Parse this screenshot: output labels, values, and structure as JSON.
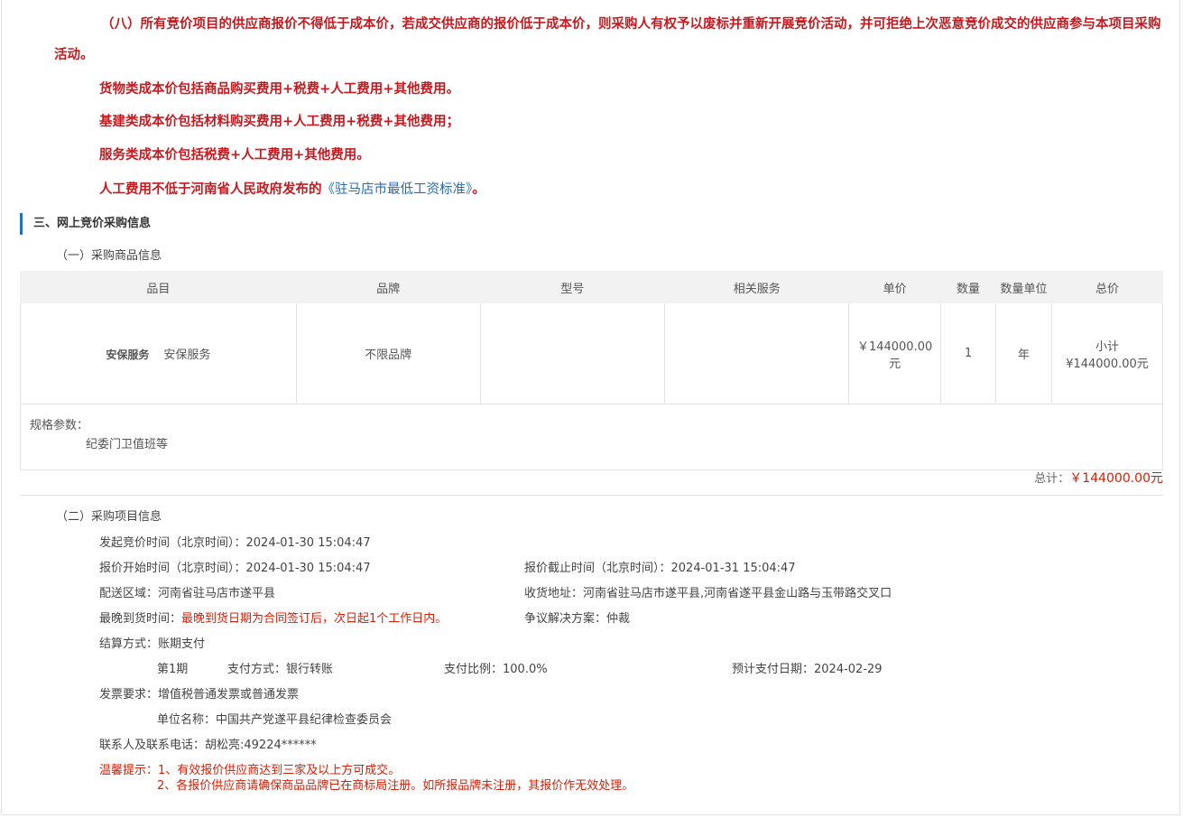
{
  "rules": {
    "item8": "（八）所有竞价项目的供应商报价不得低于成本价，若成交供应商的报价低于成本价，则采购人有权予以废标并重新开展竞价活动，并可拒绝上次恶意竞价成交的供应商参与本项目采购活动。",
    "goods_cost": "货物类成本价包括商品购买费用+税费+人工费用+其他费用。",
    "construction_cost": "基建类成本价包括材料购买费用+人工费用+税费+其他费用；",
    "service_cost": "服务类成本价包括税费+人工费用+其他费用。",
    "labor_prefix": "人工费用不低于河南省人民政府发布的",
    "labor_link": "《驻马店市最低工资标准》",
    "labor_suffix": "。"
  },
  "section3": {
    "title": "三、网上竞价采购信息",
    "sub1": "（一）采购商品信息",
    "sub2": "（二）采购项目信息"
  },
  "goods_table": {
    "headers": [
      "品目",
      "品牌",
      "型号",
      "相关服务",
      "单价",
      "数量",
      "数量单位",
      "总价"
    ],
    "row": {
      "category_code": "安保服务",
      "category_name": "安保服务",
      "brand": "不限品牌",
      "model": "",
      "service": "",
      "unit_price": "￥144000.00 元",
      "qty": "1",
      "unit": "年",
      "subtotal_label": "小计",
      "subtotal": "¥144000.00元"
    },
    "spec_label": "规格参数：",
    "spec_value": "纪委门卫值班等"
  },
  "total": {
    "label": "总计：",
    "amount": "￥144000.00元"
  },
  "project": {
    "start_label": "发起竞价时间（北京时间）：",
    "start_value": "2024-01-30 15:04:47",
    "quote_start_label": "报价开始时间（北京时间）：",
    "quote_start_value": "2024-01-30 15:04:47",
    "quote_end_label": "报价截止时间（北京时间）：",
    "quote_end_value": "2024-01-31 15:04:47",
    "delivery_area": "配送区域：河南省驻马店市遂平县",
    "receive_addr": "收货地址：河南省驻马店市遂平县,河南省遂平县金山路与玉带路交叉口",
    "latest_label": "最晚到货时间：",
    "latest_value": "最晚到货日期为合同签订后，次日起1个工作日内。",
    "dispute_label": "争议解决方案：",
    "dispute_value": "仲裁",
    "settle_label": "结算方式：",
    "settle_value": "账期支付",
    "period": "第1期",
    "pay_method_label": "支付方式：",
    "pay_method_value": "银行转账",
    "pay_ratio": "支付比例：100.0%",
    "pay_date": "预计支付日期：2024-02-29",
    "invoice_label": "发票要求：",
    "invoice_value": "增值税普通发票或普通发票",
    "unit_name": "单位名称：中国共产党遂平县纪律检查委员会",
    "contact": "联系人及联系电话：胡松亮:49224******",
    "tip_label": "温馨提示：",
    "tip1": "1、有效报价供应商达到三家及以上方可成交。",
    "tip2": "2、各报价供应商请确保商品品牌已在商标局注册。如所报品牌未注册，其报价作无效处理。"
  },
  "colors": {
    "accent": "#1f73c4",
    "red": "#c8191e",
    "link": "#2a6db0"
  }
}
